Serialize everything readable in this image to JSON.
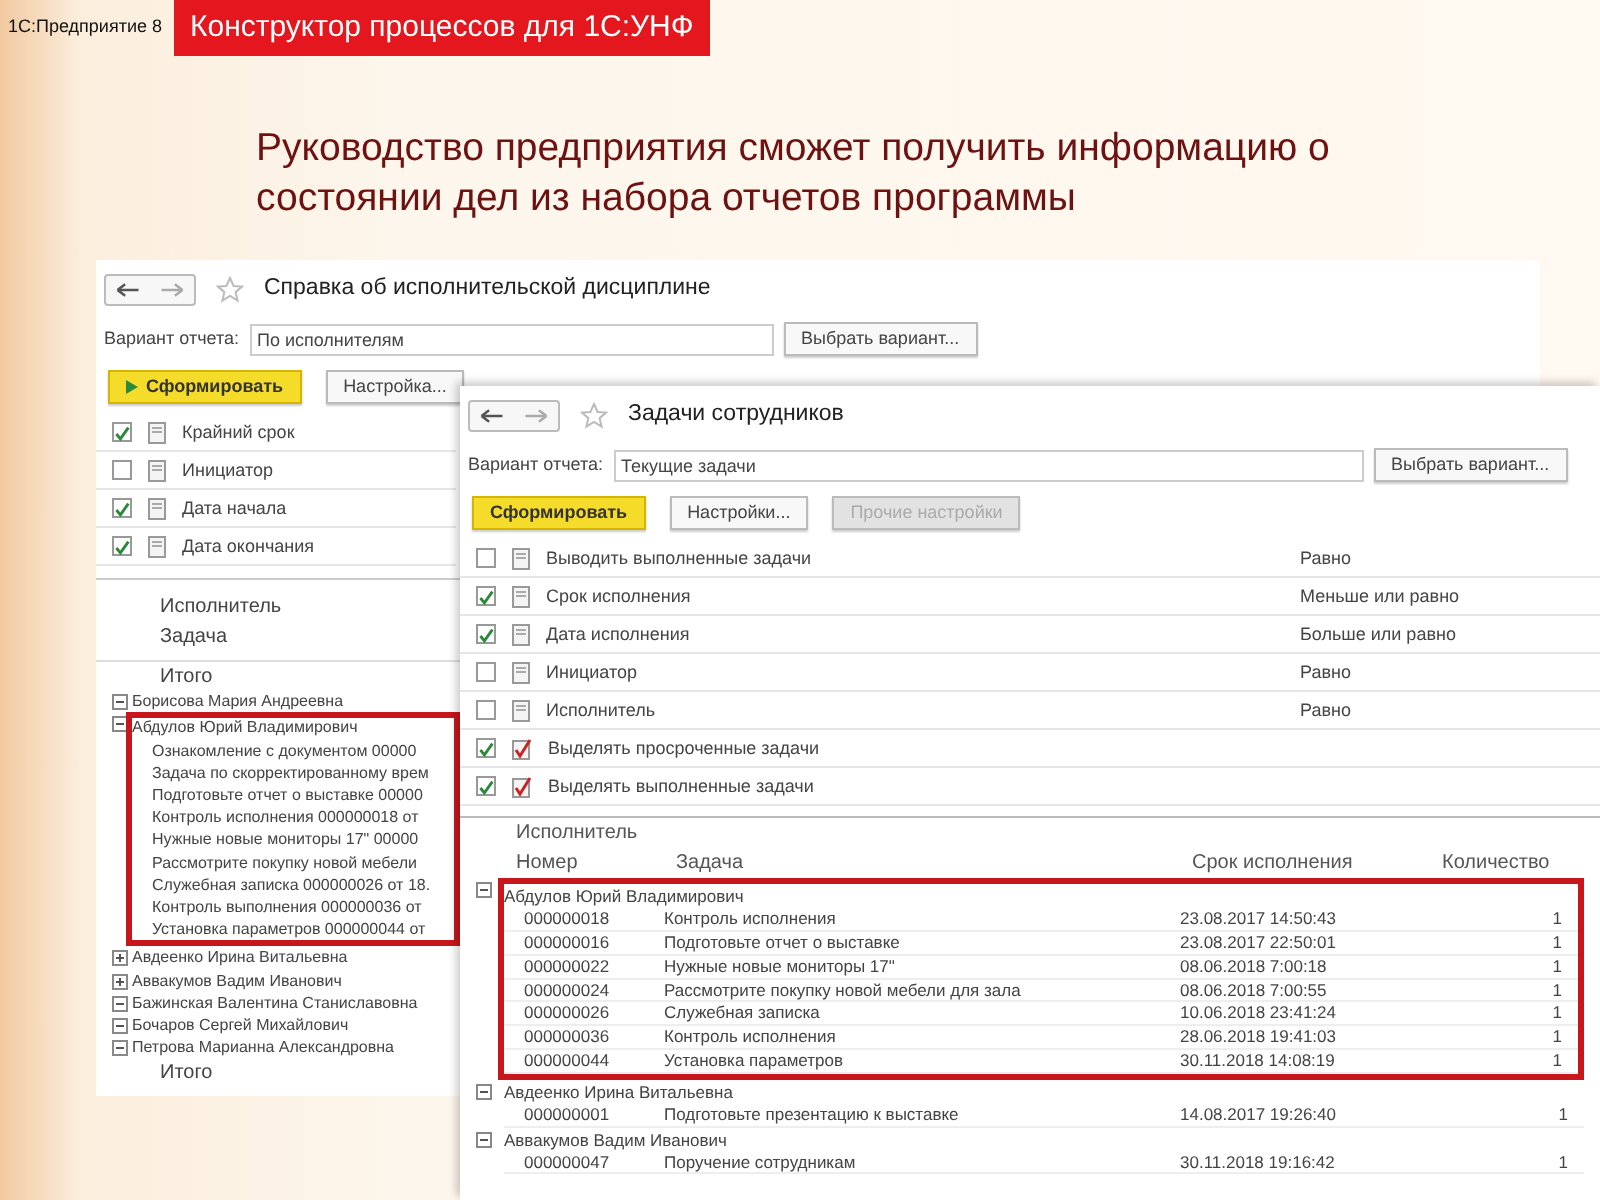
{
  "slide": {
    "brand": "1С:Предприятие 8",
    "title": "Конструктор процессов для 1С:УНФ",
    "heading": "Руководство предприятия сможет получить информацию о состоянии дел из набора отчетов программы"
  },
  "windows": [
    {
      "title": "Справка об исполнительской дисциплине",
      "variant_label": "Вариант отчета:",
      "variant_value": "По исполнителям",
      "choose_button": "Выбрать вариант...",
      "buttons": [
        {
          "label": "Сформировать",
          "kind": "primary"
        },
        {
          "label": "Настройка...",
          "kind": "normal"
        }
      ],
      "settings": [
        {
          "label": "Крайний срок",
          "checked": true,
          "kind": "field"
        },
        {
          "label": "Инициатор",
          "checked": false,
          "kind": "field"
        },
        {
          "label": "Дата начала",
          "checked": true,
          "kind": "field"
        },
        {
          "label": "Дата окончания",
          "checked": true,
          "kind": "field"
        }
      ],
      "report": {
        "headers": [
          "Исполнитель",
          "Задача"
        ],
        "total_label": "Итого",
        "groups": [
          {
            "name": "Борисова Мария Андреевна",
            "expanded": true,
            "highlighted": false
          },
          {
            "name": "Абдулов Юрий Владимирович",
            "expanded": true,
            "highlighted": true,
            "children": [
              {
                "task": "Ознакомление с документом 00000"
              },
              {
                "task": "Задача по скорректированному врем"
              },
              {
                "task": "Подготовьте отчет о выставке 00000"
              },
              {
                "task": "Контроль исполнения 000000018 от"
              },
              {
                "task": "Нужные новые мониторы 17\" 00000"
              },
              {
                "task": "Рассмотрите покупку новой мебели"
              },
              {
                "task": "Служебная записка 000000026 от 18."
              },
              {
                "task": "Контроль выполнения 000000036 от"
              },
              {
                "task": "Установка параметров 000000044 от"
              }
            ]
          },
          {
            "name": "Авдеенко Ирина Витальевна",
            "expanded": false,
            "highlighted": false
          },
          {
            "name": "Аввакумов Вадим Иванович",
            "expanded": false,
            "highlighted": false
          },
          {
            "name": "Бажинская Валентина Станиславовна",
            "expanded": true,
            "highlighted": false
          },
          {
            "name": "Бочаров Сергей Михайлович",
            "expanded": true,
            "highlighted": false
          },
          {
            "name": "Петрова Марианна Александровна",
            "expanded": true,
            "highlighted": false
          }
        ],
        "footer_total": "Итого"
      }
    },
    {
      "title": "Задачи сотрудников",
      "variant_label": "Вариант отчета:",
      "variant_value": "Текущие задачи",
      "choose_button": "Выбрать вариант...",
      "buttons": [
        {
          "label": "Сформировать",
          "kind": "primary"
        },
        {
          "label": "Настройки...",
          "kind": "normal"
        },
        {
          "label": "Прочие настройки",
          "kind": "disabled"
        }
      ],
      "settings": [
        {
          "label": "Выводить выполненные задачи",
          "checked": false,
          "kind": "field",
          "condition": "Равно"
        },
        {
          "label": "Срок исполнения",
          "checked": true,
          "kind": "field",
          "condition": "Меньше или равно"
        },
        {
          "label": "Дата исполнения",
          "checked": true,
          "kind": "field",
          "condition": "Больше или равно"
        },
        {
          "label": "Инициатор",
          "checked": false,
          "kind": "field",
          "condition": "Равно"
        },
        {
          "label": "Исполнитель",
          "checked": false,
          "kind": "field",
          "condition": "Равно"
        },
        {
          "label": "Выделять просроченные задачи",
          "checked": true,
          "kind": "flag"
        },
        {
          "label": "Выделять выполненные задачи",
          "checked": true,
          "kind": "flag"
        }
      ],
      "table": {
        "group_header": "Исполнитель",
        "columns": [
          "Номер",
          "Задача",
          "Срок исполнения",
          "Количество"
        ],
        "groups": [
          {
            "name": "Абдулов Юрий Владимирович",
            "expanded": true,
            "highlighted": true,
            "rows": [
              [
                "000000018",
                "Контроль исполнения",
                "23.08.2017 14:50:43",
                "1"
              ],
              [
                "000000016",
                "Подготовьте отчет о выставке",
                "23.08.2017 22:50:01",
                "1"
              ],
              [
                "000000022",
                "Нужные новые мониторы 17\"",
                "08.06.2018 7:00:18",
                "1"
              ],
              [
                "000000024",
                "Рассмотрите покупку новой мебели для зала",
                "08.06.2018 7:00:55",
                "1"
              ],
              [
                "000000026",
                "Служебная записка",
                "10.06.2018 23:41:24",
                "1"
              ],
              [
                "000000036",
                "Контроль исполнения",
                "28.06.2018 19:41:03",
                "1"
              ],
              [
                "000000044",
                "Установка параметров",
                "30.11.2018 14:08:19",
                "1"
              ]
            ]
          },
          {
            "name": "Авдеенко Ирина Витальевна",
            "expanded": true,
            "highlighted": false,
            "rows": [
              [
                "000000001",
                "Подготовьте презентацию к выставке",
                "14.08.2017 19:26:40",
                "1"
              ]
            ]
          },
          {
            "name": "Аввакумов Вадим Иванович",
            "expanded": true,
            "highlighted": false,
            "rows": [
              [
                "000000047",
                "Поручение сотрудникам",
                "30.11.2018 19:16:42",
                "1"
              ]
            ]
          }
        ]
      }
    }
  ]
}
